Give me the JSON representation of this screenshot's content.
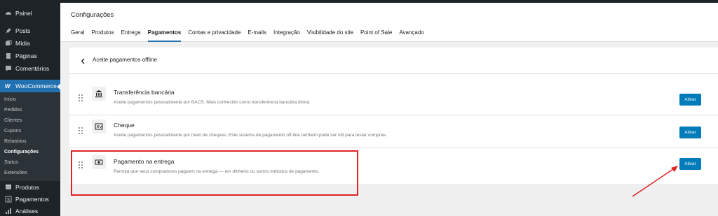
{
  "sidebar": {
    "items": [
      {
        "label": "Painel",
        "icon": "dashboard-icon"
      },
      {
        "label": "Posts",
        "icon": "pin-icon"
      },
      {
        "label": "Mídia",
        "icon": "media-icon"
      },
      {
        "label": "Páginas",
        "icon": "pages-icon"
      },
      {
        "label": "Comentários",
        "icon": "comments-icon"
      }
    ],
    "woocommerce": {
      "label": "WooCommerce",
      "icon": "woo-icon"
    },
    "submenu": [
      "Início",
      "Pedidos",
      "Clientes",
      "Cupons",
      "Relatórios",
      "Configurações",
      "Status",
      "Extensões"
    ],
    "submenu_current": "Configurações",
    "bottom_items": [
      {
        "label": "Produtos",
        "icon": "products-icon"
      },
      {
        "label": "Pagamentos",
        "icon": "dollar-icon"
      },
      {
        "label": "Análises",
        "icon": "chart-icon"
      }
    ]
  },
  "header": {
    "title": "Configurações",
    "tabs": [
      "Geral",
      "Produtos",
      "Entrega",
      "Pagamentos",
      "Contas e privacidade",
      "E-mails",
      "Integração",
      "Visibilidade do site",
      "Point of Sale",
      "Avançado"
    ],
    "active_tab": "Pagamentos"
  },
  "panel": {
    "title": "Aceite pagamentos offline",
    "gateways": [
      {
        "title": "Transferência bancária",
        "description": "Aceite pagamentos pessoalmente por BACS. Mais conhecido como transferência bancária direta.",
        "button": "Ativar",
        "icon": "bank-icon"
      },
      {
        "title": "Cheque",
        "description": "Aceite pagamentos pessoalmente por meio de cheques. Este sistema de pagamento off-line também pode ser útil para testar compras.",
        "button": "Ativar",
        "icon": "cheque-icon"
      },
      {
        "title": "Pagamento na entrega",
        "description": "Permita que seus compradores paguem na entrega — em dinheiro ou outros métodos de pagamento.",
        "button": "Ativar",
        "icon": "cash-icon"
      }
    ]
  },
  "colors": {
    "sidebar_bg": "#1d2327",
    "accent": "#2271b1",
    "button": "#007cba",
    "annotation": "#e02424"
  }
}
